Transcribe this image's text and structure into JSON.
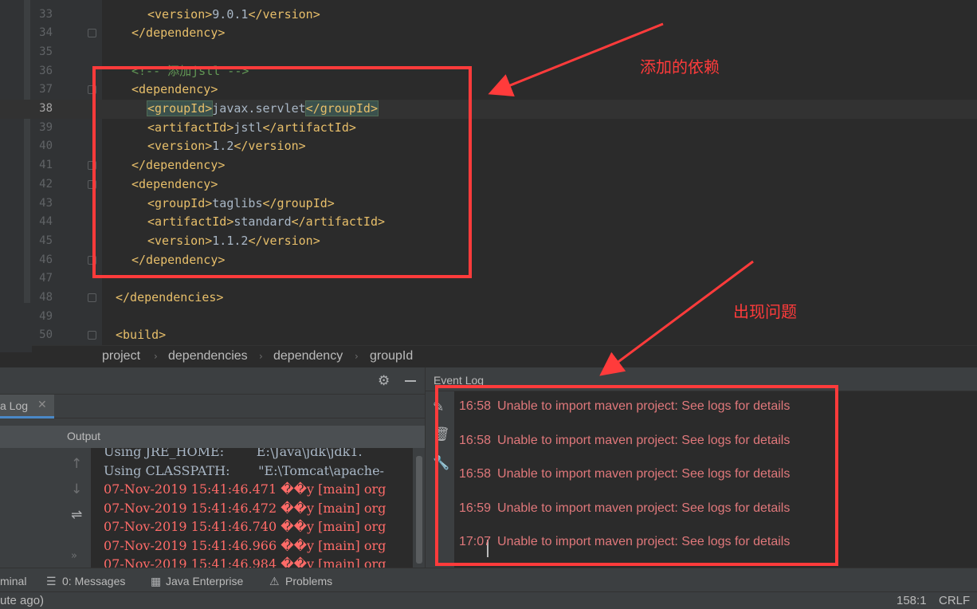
{
  "editor": {
    "lines": [
      {
        "num": "33",
        "indent": 2,
        "parts": [
          {
            "t": "tag",
            "v": "<version>"
          },
          {
            "t": "txt",
            "v": "9.0.1"
          },
          {
            "t": "tag",
            "v": "</version>"
          }
        ]
      },
      {
        "num": "34",
        "indent": 1,
        "parts": [
          {
            "t": "tag",
            "v": "</dependency>"
          }
        ]
      },
      {
        "num": "35",
        "indent": 0,
        "parts": []
      },
      {
        "num": "36",
        "indent": 1,
        "parts": [
          {
            "t": "cmt",
            "v": "<!-- 添加jstl -->"
          }
        ]
      },
      {
        "num": "37",
        "indent": 1,
        "parts": [
          {
            "t": "tag",
            "v": "<dependency>"
          }
        ]
      },
      {
        "num": "38",
        "indent": 2,
        "parts": [
          {
            "t": "tag hl",
            "v": "<groupId>"
          },
          {
            "t": "txt",
            "v": "javax.servlet"
          },
          {
            "t": "tag hl",
            "v": "</groupId>"
          }
        ]
      },
      {
        "num": "39",
        "indent": 2,
        "parts": [
          {
            "t": "tag",
            "v": "<artifactId>"
          },
          {
            "t": "txt",
            "v": "jstl"
          },
          {
            "t": "tag",
            "v": "</artifactId>"
          }
        ]
      },
      {
        "num": "40",
        "indent": 2,
        "parts": [
          {
            "t": "tag",
            "v": "<version>"
          },
          {
            "t": "txt",
            "v": "1.2"
          },
          {
            "t": "tag",
            "v": "</version>"
          }
        ]
      },
      {
        "num": "41",
        "indent": 1,
        "parts": [
          {
            "t": "tag",
            "v": "</dependency>"
          }
        ]
      },
      {
        "num": "42",
        "indent": 1,
        "parts": [
          {
            "t": "tag",
            "v": "<dependency>"
          }
        ]
      },
      {
        "num": "43",
        "indent": 2,
        "parts": [
          {
            "t": "tag",
            "v": "<groupId>"
          },
          {
            "t": "txt",
            "v": "taglibs"
          },
          {
            "t": "tag",
            "v": "</groupId>"
          }
        ]
      },
      {
        "num": "44",
        "indent": 2,
        "parts": [
          {
            "t": "tag",
            "v": "<artifactId>"
          },
          {
            "t": "txt",
            "v": "standard"
          },
          {
            "t": "tag",
            "v": "</artifactId>"
          }
        ]
      },
      {
        "num": "45",
        "indent": 2,
        "parts": [
          {
            "t": "tag",
            "v": "<version>"
          },
          {
            "t": "txt",
            "v": "1.1.2"
          },
          {
            "t": "tag",
            "v": "</version>"
          }
        ]
      },
      {
        "num": "46",
        "indent": 1,
        "parts": [
          {
            "t": "tag",
            "v": "</dependency>"
          }
        ]
      },
      {
        "num": "47",
        "indent": 0,
        "parts": []
      },
      {
        "num": "48",
        "indent": 0,
        "parts": [
          {
            "t": "tag",
            "v": "</dependencies>"
          }
        ]
      },
      {
        "num": "49",
        "indent": 0,
        "parts": []
      },
      {
        "num": "50",
        "indent": 0,
        "parts": [
          {
            "t": "tag",
            "v": "<build>"
          }
        ]
      }
    ],
    "current_line": "38"
  },
  "breadcrumb": [
    "project",
    "dependencies",
    "dependency",
    "groupId"
  ],
  "run_panel": {
    "tab_label": "a Log",
    "output_label": "Output",
    "console_lines": [
      {
        "text": "Using JRE_HOME:        E:\\Java\\jdk\\jdk1.",
        "color": "grey"
      },
      {
        "text": "Using CLASSPATH:       \"E:\\Tomcat\\apache-",
        "color": "grey"
      },
      {
        "text": "07-Nov-2019 15:41:46.471 ��y [main] org",
        "color": "red"
      },
      {
        "text": "07-Nov-2019 15:41:46.472 ��y [main] org",
        "color": "red"
      },
      {
        "text": "07-Nov-2019 15:41:46.740 ��y [main] org",
        "color": "red"
      },
      {
        "text": "07-Nov-2019 15:41:46.966 ��y [main] org",
        "color": "red"
      },
      {
        "text": "07-Nov-2019 15:41:46.984 ��y [main] org",
        "color": "red"
      }
    ]
  },
  "event_log": {
    "title": "Event Log",
    "entries": [
      {
        "time": "16:58",
        "message": "Unable to import maven project: See logs for details"
      },
      {
        "time": "16:58",
        "message": "Unable to import maven project: See logs for details"
      },
      {
        "time": "16:58",
        "message": "Unable to import maven project: See logs for details"
      },
      {
        "time": "16:59",
        "message": "Unable to import maven project: See logs for details"
      },
      {
        "time": "17:07",
        "message": "Unable to import maven project: See logs for details"
      }
    ]
  },
  "tool_strip": {
    "terminal": "minal",
    "messages": "0: Messages",
    "java_enterprise": "Java Enterprise",
    "problems": "Problems"
  },
  "status_bar": {
    "left": "ute ago)",
    "position": "158:1",
    "line_sep": "CRLF"
  },
  "annotations": {
    "added_dependency": "添加的依赖",
    "problem_appears": "出现问题",
    "color": "#ff3b3b"
  }
}
